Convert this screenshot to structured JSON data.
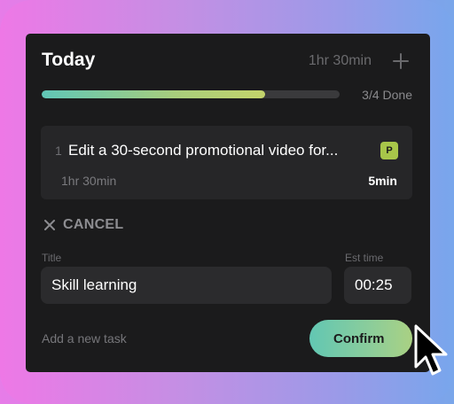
{
  "header": {
    "title": "Today",
    "total_duration": "1hr 30min",
    "add_icon": "plus-icon"
  },
  "progress": {
    "done": 3,
    "total": 4,
    "label": "3/4 Done",
    "fill_fraction": 0.75
  },
  "task": {
    "index": "1",
    "title": "Edit a 30-second promotional video for...",
    "badge": "P",
    "estimate": "1hr 30min",
    "elapsed": "5min"
  },
  "form": {
    "cancel_label": "CANCEL",
    "title_label": "Title",
    "title_value": "Skill learning",
    "time_label": "Est time",
    "time_value": "00:25",
    "add_task_label": "Add a new task",
    "confirm_label": "Confirm"
  },
  "colors": {
    "card_bg": "#1b1b1c",
    "accent_teal": "#60c6b7",
    "accent_green": "#a8cd7c",
    "badge": "#a8c64a"
  }
}
